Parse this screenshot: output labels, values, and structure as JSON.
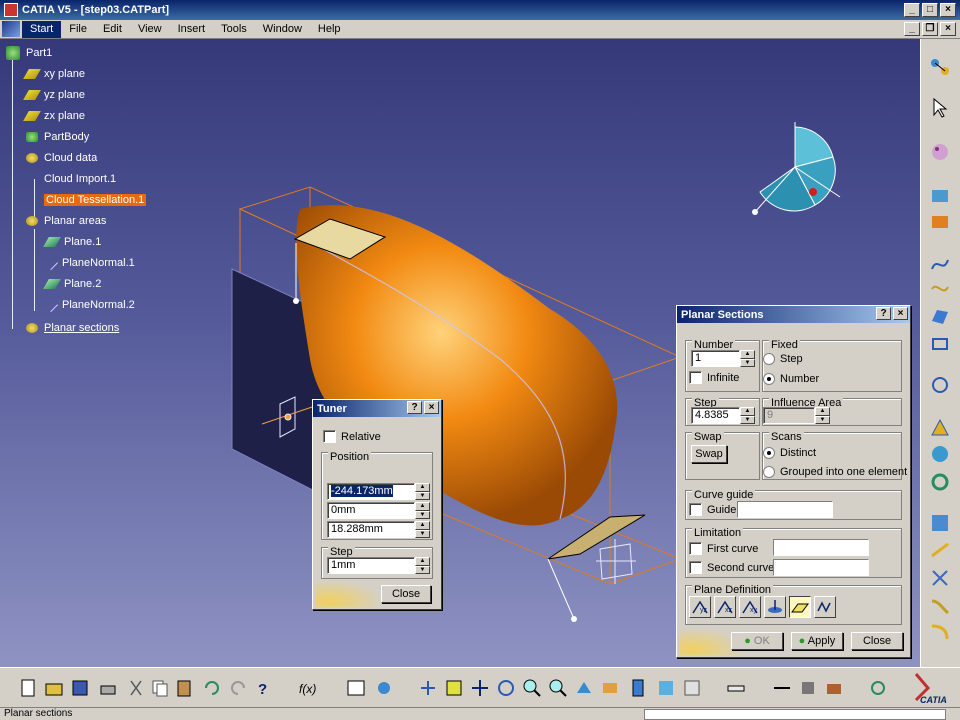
{
  "window": {
    "title": "CATIA V5 - [step03.CATPart]"
  },
  "menu": [
    "Start",
    "File",
    "Edit",
    "View",
    "Insert",
    "Tools",
    "Window",
    "Help"
  ],
  "tree": {
    "root": "Part1",
    "items": [
      {
        "label": "xy plane",
        "icon": "plane-icon"
      },
      {
        "label": "yz plane",
        "icon": "plane-icon"
      },
      {
        "label": "zx plane",
        "icon": "plane-icon"
      },
      {
        "label": "PartBody",
        "icon": "partbody-icon"
      },
      {
        "label": "Cloud data",
        "icon": "cloud-icon"
      },
      {
        "label": "Cloud Import.1",
        "icon": "none"
      },
      {
        "label": "Cloud Tessellation.1",
        "icon": "none",
        "selected": true
      },
      {
        "label": "Planar areas",
        "icon": "cloud-icon"
      },
      {
        "label": "Plane.1",
        "icon": "plane-icon"
      },
      {
        "label": "PlaneNormal.1",
        "icon": "line-icon"
      },
      {
        "label": "Plane.2",
        "icon": "plane-icon"
      },
      {
        "label": "PlaneNormal.2",
        "icon": "line-icon"
      },
      {
        "label": "Planar sections",
        "icon": "cloud-icon"
      }
    ]
  },
  "tuner": {
    "title": "Tuner",
    "relative_label": "Relative",
    "position_label": "Position",
    "pos1": "-244.173mm",
    "pos2": "0mm",
    "pos3": "18.288mm",
    "step_label": "Step",
    "step_value": "1mm",
    "close_label": "Close"
  },
  "planar_sections": {
    "title": "Planar Sections",
    "number_label": "Number",
    "number_value": "1",
    "infinite_label": "Infinite",
    "fixed_label": "Fixed",
    "fixed_step_label": "Step",
    "fixed_number_label": "Number",
    "step_label": "Step",
    "step_value": "4.8385",
    "influence_label": "Influence Area",
    "influence_value": "9",
    "swap_group_label": "Swap",
    "swap_button_label": "Swap",
    "scans_label": "Scans",
    "distinct_label": "Distinct",
    "grouped_label": "Grouped into one element",
    "curve_guide_label": "Curve guide",
    "guide_label": "Guide",
    "limitation_label": "Limitation",
    "first_curve_label": "First curve",
    "second_curve_label": "Second curve",
    "plane_def_label": "Plane Definition",
    "ok_label": "OK",
    "apply_label": "Apply",
    "close_label": "Close"
  },
  "status": {
    "text": "Planar sections"
  },
  "colors": {
    "accent": "#0a246a",
    "selection": "#e66a10",
    "part": "#f07c10"
  }
}
